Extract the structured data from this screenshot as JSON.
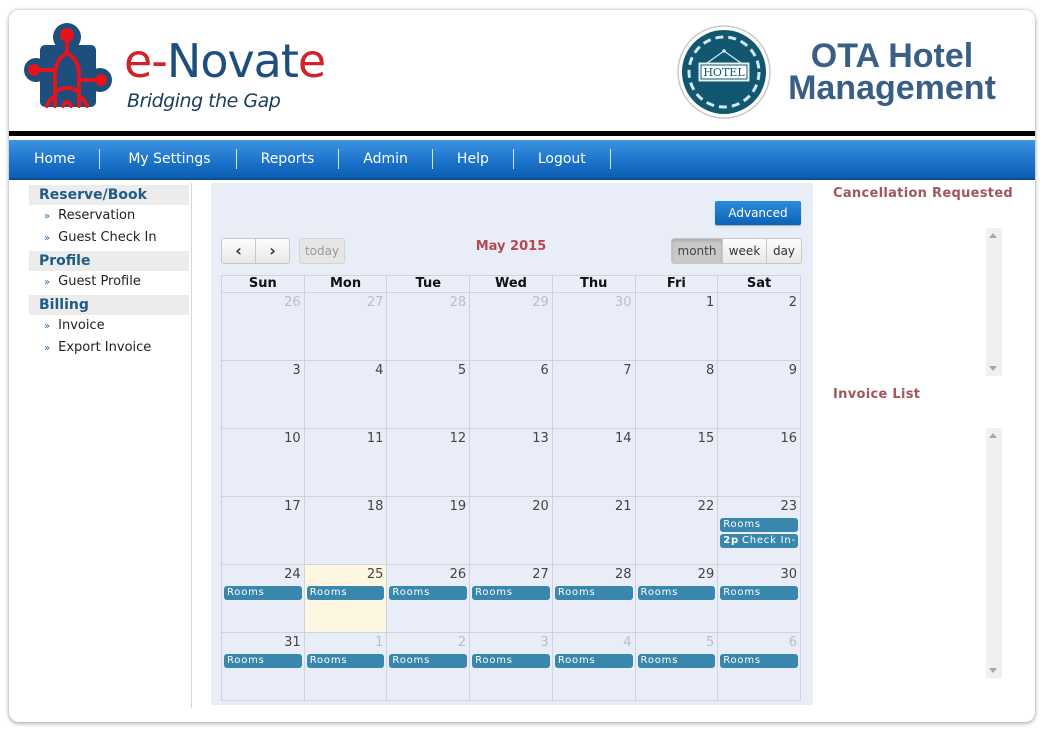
{
  "brand": {
    "name_prefix": "e-",
    "name_mid": "Novat",
    "name_suffix": "e",
    "tagline": "Bridging the Gap",
    "primary_color": "#1d4e7d",
    "accent_color": "#d2232a"
  },
  "app": {
    "title_line1": "OTA Hotel",
    "title_line2": "Management",
    "badge_text": "HOTEL"
  },
  "nav": {
    "items": [
      {
        "label": "Home"
      },
      {
        "label": "My Settings"
      },
      {
        "label": "Reports"
      },
      {
        "label": "Admin"
      },
      {
        "label": "Help"
      },
      {
        "label": "Logout"
      }
    ]
  },
  "sidebar": {
    "groups": [
      {
        "title": "Reserve/Book",
        "items": [
          {
            "label": "Reservation"
          },
          {
            "label": "Guest Check In"
          }
        ]
      },
      {
        "title": "Profile",
        "items": [
          {
            "label": "Guest Profile"
          }
        ]
      },
      {
        "title": "Billing",
        "items": [
          {
            "label": "Invoice"
          },
          {
            "label": "Export Invoice"
          }
        ]
      }
    ]
  },
  "calendar": {
    "advanced_label": "Advanced",
    "prev_label": "‹",
    "next_label": "›",
    "today_label": "today",
    "title": "May 2015",
    "views": [
      {
        "label": "month",
        "active": true
      },
      {
        "label": "week",
        "active": false
      },
      {
        "label": "day",
        "active": false
      }
    ],
    "weekdays": [
      "Sun",
      "Mon",
      "Tue",
      "Wed",
      "Thu",
      "Fri",
      "Sat"
    ],
    "event_color": "#3a87ad",
    "today_date": 25,
    "weeks": [
      [
        {
          "day": "26",
          "other": true,
          "events": []
        },
        {
          "day": "27",
          "other": true,
          "events": []
        },
        {
          "day": "28",
          "other": true,
          "events": []
        },
        {
          "day": "29",
          "other": true,
          "events": []
        },
        {
          "day": "30",
          "other": true,
          "events": []
        },
        {
          "day": "1",
          "other": false,
          "events": []
        },
        {
          "day": "2",
          "other": false,
          "events": []
        }
      ],
      [
        {
          "day": "3",
          "other": false,
          "events": []
        },
        {
          "day": "4",
          "other": false,
          "events": []
        },
        {
          "day": "5",
          "other": false,
          "events": []
        },
        {
          "day": "6",
          "other": false,
          "events": []
        },
        {
          "day": "7",
          "other": false,
          "events": []
        },
        {
          "day": "8",
          "other": false,
          "events": []
        },
        {
          "day": "9",
          "other": false,
          "events": []
        }
      ],
      [
        {
          "day": "10",
          "other": false,
          "events": []
        },
        {
          "day": "11",
          "other": false,
          "events": []
        },
        {
          "day": "12",
          "other": false,
          "events": []
        },
        {
          "day": "13",
          "other": false,
          "events": []
        },
        {
          "day": "14",
          "other": false,
          "events": []
        },
        {
          "day": "15",
          "other": false,
          "events": []
        },
        {
          "day": "16",
          "other": false,
          "events": []
        }
      ],
      [
        {
          "day": "17",
          "other": false,
          "events": []
        },
        {
          "day": "18",
          "other": false,
          "events": []
        },
        {
          "day": "19",
          "other": false,
          "events": []
        },
        {
          "day": "20",
          "other": false,
          "events": []
        },
        {
          "day": "21",
          "other": false,
          "events": []
        },
        {
          "day": "22",
          "other": false,
          "events": []
        },
        {
          "day": "23",
          "other": false,
          "events": [
            {
              "time": "",
              "title": "Rooms"
            },
            {
              "time": "2p",
              "title": "Check In-"
            }
          ]
        }
      ],
      [
        {
          "day": "24",
          "other": false,
          "events": [
            {
              "time": "",
              "title": "Rooms"
            }
          ]
        },
        {
          "day": "25",
          "other": false,
          "today": true,
          "events": [
            {
              "time": "",
              "title": "Rooms"
            }
          ]
        },
        {
          "day": "26",
          "other": false,
          "events": [
            {
              "time": "",
              "title": "Rooms"
            }
          ]
        },
        {
          "day": "27",
          "other": false,
          "events": [
            {
              "time": "",
              "title": "Rooms"
            }
          ]
        },
        {
          "day": "28",
          "other": false,
          "events": [
            {
              "time": "",
              "title": "Rooms"
            }
          ]
        },
        {
          "day": "29",
          "other": false,
          "events": [
            {
              "time": "",
              "title": "Rooms"
            }
          ]
        },
        {
          "day": "30",
          "other": false,
          "events": [
            {
              "time": "",
              "title": "Rooms"
            }
          ]
        }
      ],
      [
        {
          "day": "31",
          "other": false,
          "events": [
            {
              "time": "",
              "title": "Rooms"
            }
          ]
        },
        {
          "day": "1",
          "other": true,
          "events": [
            {
              "time": "",
              "title": "Rooms"
            }
          ]
        },
        {
          "day": "2",
          "other": true,
          "events": [
            {
              "time": "",
              "title": "Rooms"
            }
          ]
        },
        {
          "day": "3",
          "other": true,
          "events": [
            {
              "time": "",
              "title": "Rooms"
            }
          ]
        },
        {
          "day": "4",
          "other": true,
          "events": [
            {
              "time": "",
              "title": "Rooms"
            }
          ]
        },
        {
          "day": "5",
          "other": true,
          "events": [
            {
              "time": "",
              "title": "Rooms"
            }
          ]
        },
        {
          "day": "6",
          "other": true,
          "events": [
            {
              "time": "",
              "title": "Rooms"
            }
          ]
        }
      ]
    ]
  },
  "right_panel": {
    "cancellation_title": "Cancellation Requested",
    "invoice_title": "Invoice List"
  }
}
